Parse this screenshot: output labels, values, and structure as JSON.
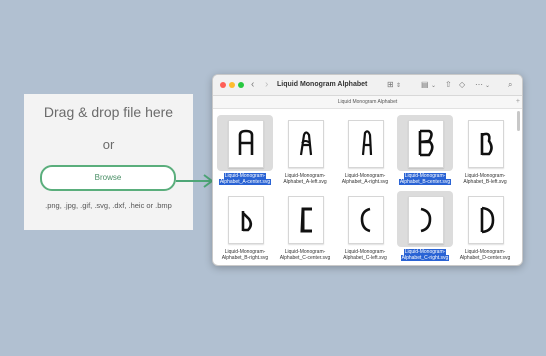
{
  "drop": {
    "title": "Drag & drop file here",
    "or": "or",
    "browse": "Browse",
    "formats": ".png, .jpg, .gif, .svg, .dxf, .heic or .bmp"
  },
  "colors": {
    "accent": "#5aae7c",
    "selection": "#2a63d4",
    "background": "#b1c0d1"
  },
  "window": {
    "title": "Liquid Monogram Alphabet",
    "path": "Liquid Monogram Alphabet",
    "toolbar_icons": [
      "grid-view-icon",
      "group-icon",
      "share-icon",
      "tag-icon",
      "more-icon",
      "search-icon"
    ]
  },
  "files": [
    {
      "line1": "Liquid-Monogram-",
      "line2": "Alphabet_A-center.svg",
      "selected": true,
      "glyph": "A"
    },
    {
      "line1": "Liquid-Monogram-",
      "line2": "Alphabet_A-left.svg",
      "selected": false,
      "glyph": "a"
    },
    {
      "line1": "Liquid-Monogram-",
      "line2": "Alphabet_A-right.svg",
      "selected": false,
      "glyph": "Ɐ"
    },
    {
      "line1": "Liquid-Monogram-",
      "line2": "Alphabet_B-center.svg",
      "selected": true,
      "glyph": "B"
    },
    {
      "line1": "Liquid-Monogram-",
      "line2": "Alphabet_B-left.svg",
      "selected": false,
      "glyph": "ϐ"
    },
    {
      "line1": "Liquid-Monogram-",
      "line2": "Alphabet_B-right.svg",
      "selected": false,
      "glyph": "ʙ"
    },
    {
      "line1": "Liquid-Monogram-",
      "line2": "Alphabet_C-center.svg",
      "selected": false,
      "glyph": "C"
    },
    {
      "line1": "Liquid-Monogram-",
      "line2": "Alphabet_C-left.svg",
      "selected": false,
      "glyph": "c"
    },
    {
      "line1": "Liquid-Monogram-",
      "line2": "Alphabet_C-right.svg",
      "selected": true,
      "glyph": "Ↄ"
    },
    {
      "line1": "Liquid-Monogram-",
      "line2": "Alphabet_D-center.svg",
      "selected": false,
      "glyph": "D"
    }
  ]
}
